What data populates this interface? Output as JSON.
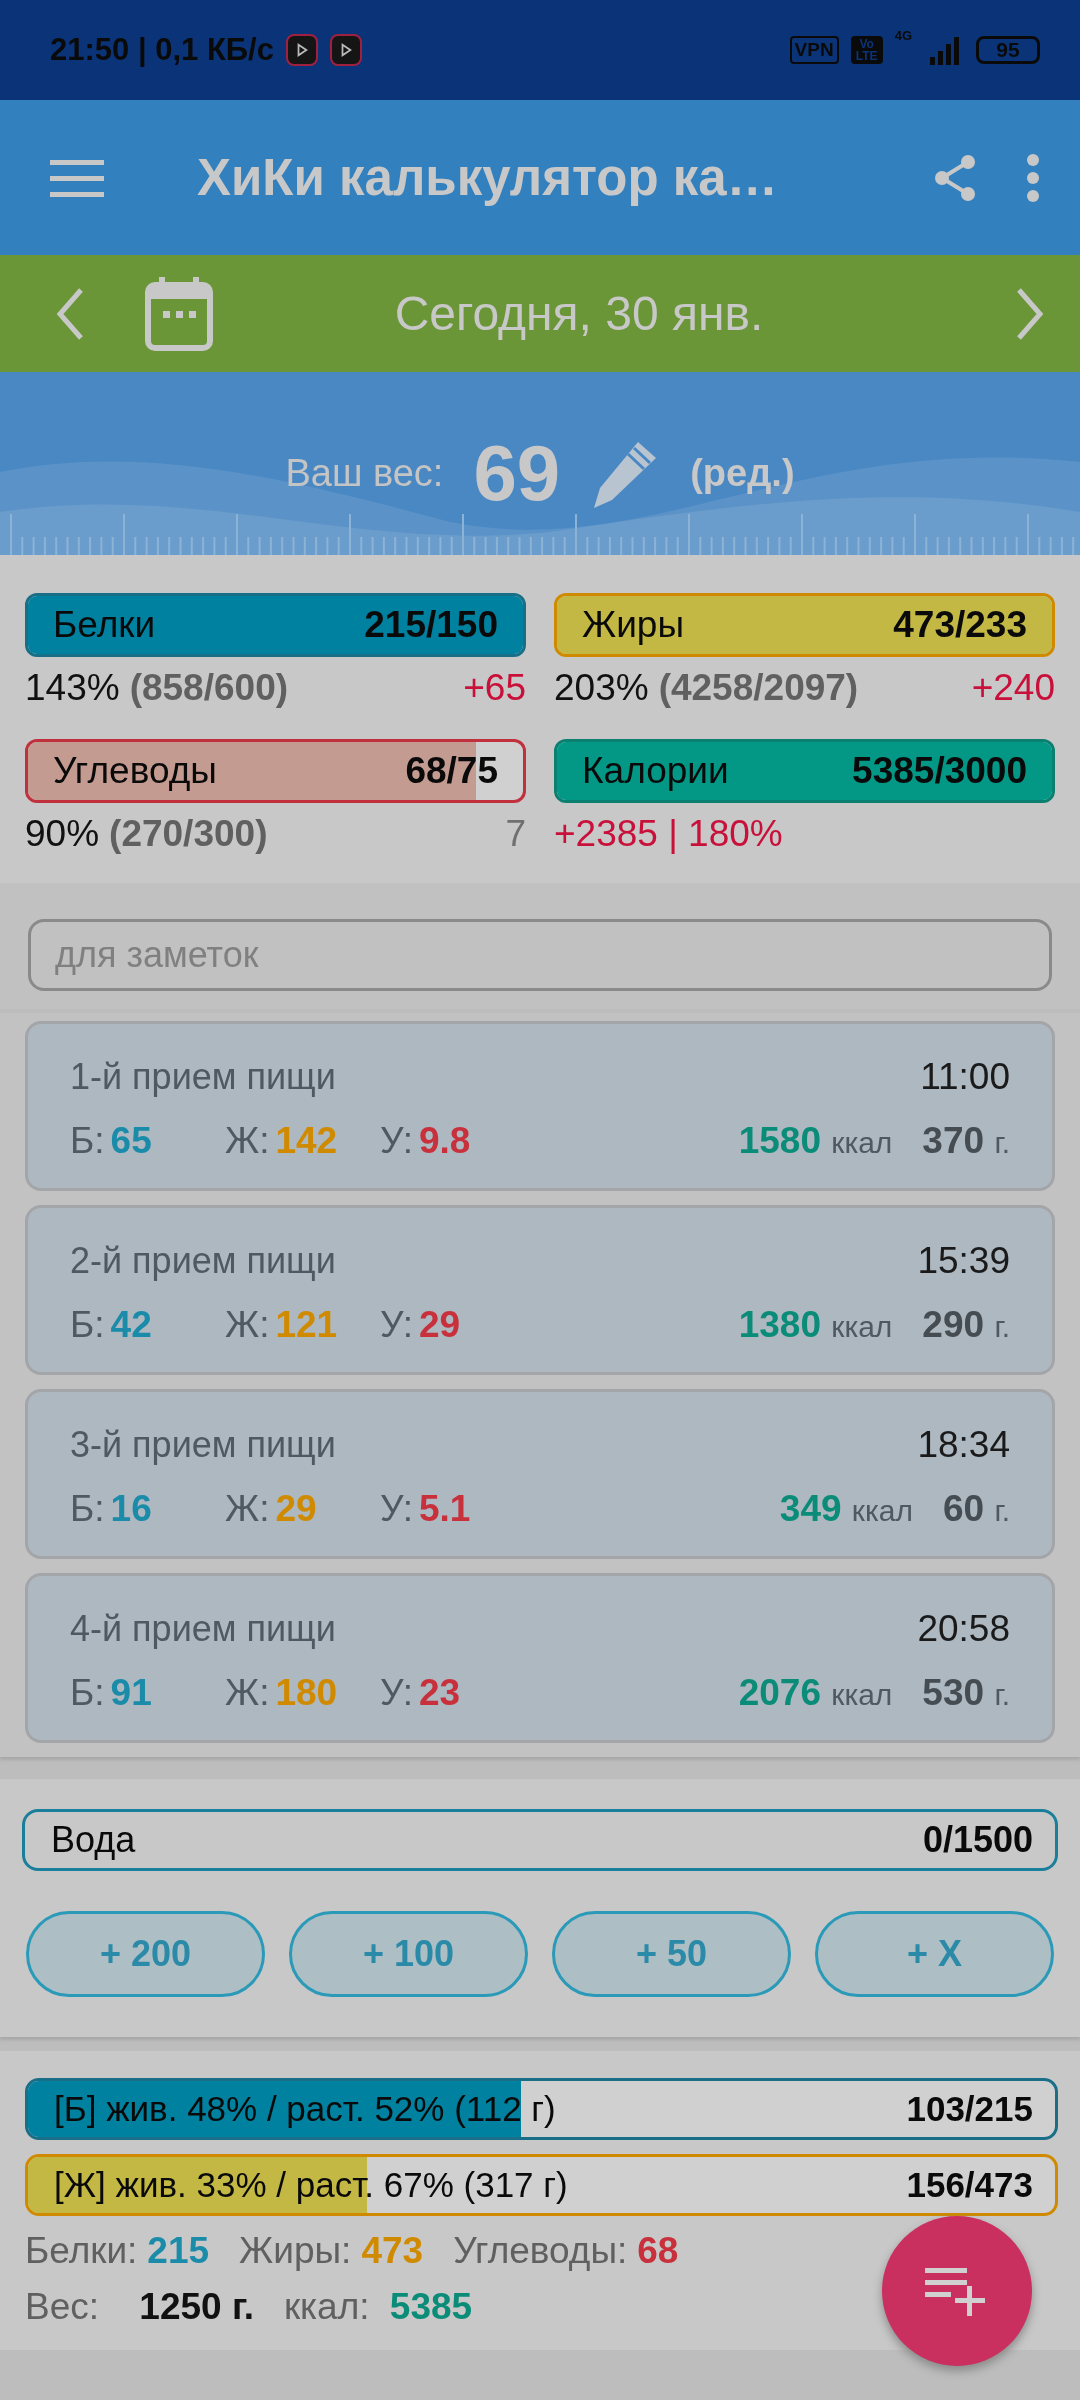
{
  "status_bar": {
    "time": "21:50 | 0,1 КБ/с",
    "vpn": "VPN",
    "volte": "Vo LTE",
    "network": "4G",
    "battery": "95"
  },
  "app_bar": {
    "title": "ХиКи калькулятор ка…"
  },
  "date_bar": {
    "date": "Сегодня, 30 янв."
  },
  "weight": {
    "label": "Ваш вес:",
    "value": "69",
    "edit": "(ред.)"
  },
  "macros": [
    {
      "kind": "protein",
      "name": "Белки",
      "value": "215/150",
      "level": 1,
      "percent": "143%",
      "detail": "(858/600)",
      "delta": "+65",
      "over": true
    },
    {
      "kind": "fat",
      "name": "Жиры",
      "value": "473/233",
      "level": 1,
      "percent": "203%",
      "detail": "(4258/2097)",
      "delta": "+240",
      "over": true
    },
    {
      "kind": "carbs",
      "name": "Углеводы",
      "value": "68/75",
      "level": 0.906,
      "percent": "90%",
      "detail": "(270/300)",
      "delta": "7",
      "over": false
    },
    {
      "kind": "kcal",
      "name": "Калории",
      "value": "5385/3000",
      "level": 1,
      "note": "+2385 | 180%",
      "over": true
    }
  ],
  "notes": {
    "placeholder": "для заметок"
  },
  "meals": [
    {
      "name": "1-й прием пищи",
      "time": "11:00",
      "values": [
        {
          "kind": "protein",
          "label": "Б:",
          "value": "65"
        },
        {
          "kind": "fat",
          "label": "Ж:",
          "value": "142"
        },
        {
          "kind": "carbs",
          "label": "У:",
          "value": "9.8"
        }
      ],
      "kcal": "1580",
      "kcal_unit": "ккал",
      "grams": "370",
      "grams_unit": "г."
    },
    {
      "name": "2-й прием пищи",
      "time": "15:39",
      "values": [
        {
          "kind": "protein",
          "label": "Б:",
          "value": "42"
        },
        {
          "kind": "fat",
          "label": "Ж:",
          "value": "121"
        },
        {
          "kind": "carbs",
          "label": "У:",
          "value": "29"
        }
      ],
      "kcal": "1380",
      "kcal_unit": "ккал",
      "grams": "290",
      "grams_unit": "г."
    },
    {
      "name": "3-й прием пищи",
      "time": "18:34",
      "values": [
        {
          "kind": "protein",
          "label": "Б:",
          "value": "16"
        },
        {
          "kind": "fat",
          "label": "Ж:",
          "value": "29"
        },
        {
          "kind": "carbs",
          "label": "У:",
          "value": "5.1"
        }
      ],
      "kcal": "349",
      "kcal_unit": "ккал",
      "grams": "60",
      "grams_unit": "г."
    },
    {
      "name": "4-й прием пищи",
      "time": "20:58",
      "values": [
        {
          "kind": "protein",
          "label": "Б:",
          "value": "91"
        },
        {
          "kind": "fat",
          "label": "Ж:",
          "value": "180"
        },
        {
          "kind": "carbs",
          "label": "У:",
          "value": "23"
        }
      ],
      "kcal": "2076",
      "kcal_unit": "ккал",
      "grams": "530",
      "grams_unit": "г."
    }
  ],
  "water": {
    "label": "Вода",
    "value": "0/1500",
    "buttons": [
      "+ 200",
      "+ 100",
      "+ 50",
      "+ X"
    ]
  },
  "summary": {
    "bars": [
      {
        "kind": "protein",
        "text": "[Б] жив. 48% / раст. 52% (112 г)",
        "value": "103/215",
        "level": 0.48
      },
      {
        "kind": "fat",
        "text": "[Ж] жив. 33% / раст. 67% (317 г)",
        "value": "156/473",
        "level": 0.33
      }
    ],
    "totals": [
      {
        "kind": "protein",
        "label": "Белки:",
        "value": "215"
      },
      {
        "kind": "fat",
        "label": "Жиры:",
        "value": "473"
      },
      {
        "kind": "carbs",
        "label": "Углеводы:",
        "value": "68"
      }
    ],
    "totals2": [
      {
        "kind": "weight",
        "label": "Вес:",
        "value": "1250 г."
      },
      {
        "kind": "kcal",
        "label": "ккал:",
        "value": "5385"
      }
    ]
  }
}
